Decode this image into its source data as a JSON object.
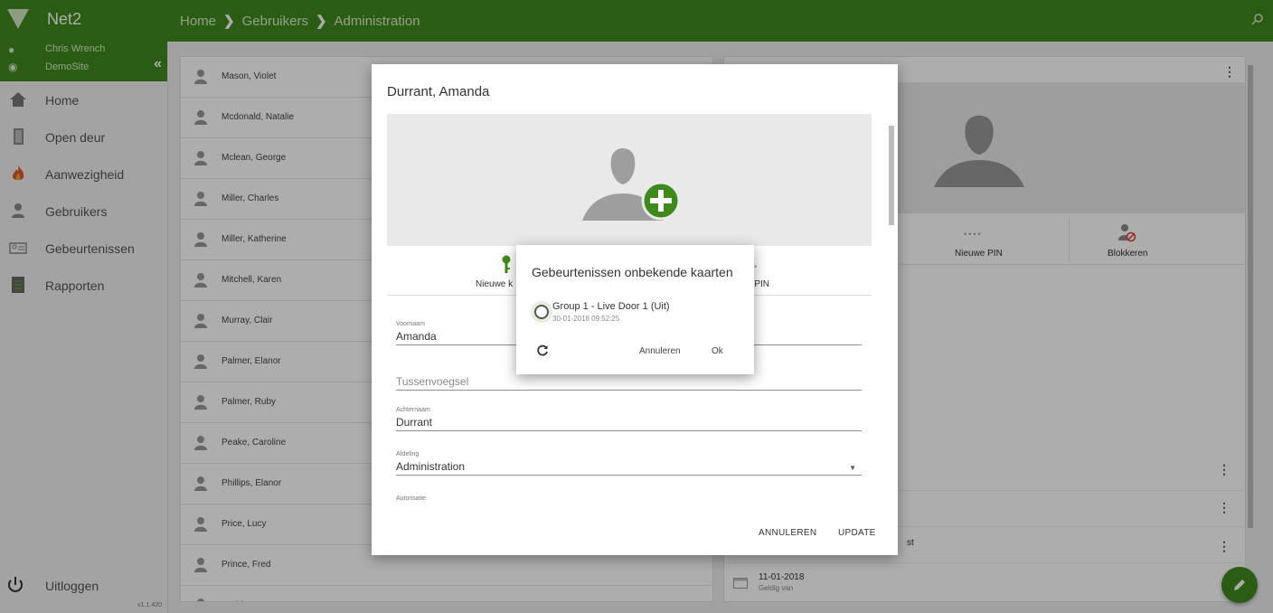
{
  "app": {
    "name": "Net2"
  },
  "breadcrumb": [
    "Home",
    "Gebruikers",
    "Administration"
  ],
  "sidebar": {
    "user_name": "Chris Wrench",
    "site": "DemoSite",
    "items": [
      {
        "label": "Home",
        "icon": "home-icon"
      },
      {
        "label": "Open deur",
        "icon": "door-icon"
      },
      {
        "label": "Aanwezigheid",
        "icon": "fire-icon"
      },
      {
        "label": "Gebruikers",
        "icon": "person-icon"
      },
      {
        "label": "Gebeurtenissen",
        "icon": "events-icon"
      },
      {
        "label": "Rapporten",
        "icon": "report-icon"
      }
    ],
    "logout": "Uitloggen",
    "version": "v1.1.420"
  },
  "user_list": [
    "Mason, Violet",
    "Mcdonald, Natalie",
    "Mclean, George",
    "Miller, Charles",
    "Miller, Katherine",
    "Mitchell, Karen",
    "Murray, Clair",
    "Palmer, Elanor",
    "Palmer, Ruby",
    "Peake, Caroline",
    "Phillips, Elanor",
    "Price, Lucy",
    "Prince, Fred",
    "Rodriguez, Jon"
  ],
  "right_panel": {
    "buttons": [
      "Nieuwe PIN",
      "Blokkeren"
    ],
    "pin_dots": "••••",
    "rows": [
      {
        "main": "st",
        "sub": ""
      },
      {
        "main": "11-01-2018",
        "sub": "Geldig van"
      }
    ]
  },
  "edit_dialog": {
    "title": "Durrant, Amanda",
    "actions": [
      "Nieuwe k",
      "e PIN"
    ],
    "fields": [
      {
        "label": "Voornaam",
        "value": "Amanda"
      },
      {
        "label": "",
        "placeholder": "Tussenvoegsel"
      },
      {
        "label": "Achternaam",
        "value": "Durrant"
      },
      {
        "label": "Afdeling",
        "value": "Administration"
      },
      {
        "label": "Autorisatie",
        "value": ""
      }
    ],
    "cancel_label": "ANNULEREN",
    "update_label": "UPDATE"
  },
  "unknown_cards_dialog": {
    "title": "Gebeurtenissen onbekende kaarten",
    "option_main": "Group 1 - Live Door 1 (Uit)",
    "option_sub": "30-01-2018 09:52:25",
    "cancel_label": "Annuleren",
    "ok_label": "Ok"
  },
  "colors": {
    "brand_green": "#3f8a1c",
    "light_green": "#d7ecc9"
  }
}
